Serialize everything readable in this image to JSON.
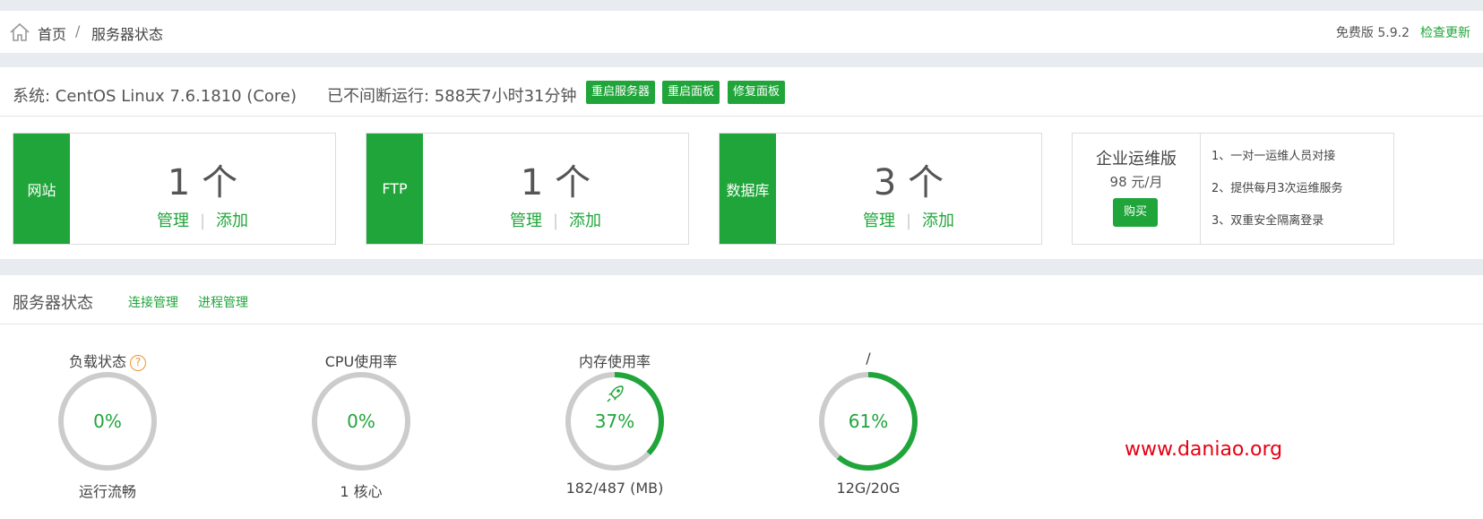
{
  "header": {
    "home_label": "首页",
    "separator": "/",
    "current": "服务器状态",
    "version": "免费版 5.9.2",
    "check_update": "检查更新"
  },
  "system": {
    "os": "系统: CentOS Linux 7.6.1810 (Core)",
    "uptime": "已不间断运行: 588天7小时31分钟",
    "buttons": [
      "重启服务器",
      "重启面板",
      "修复面板"
    ]
  },
  "cards": [
    {
      "tag": "网站",
      "count": "1 个",
      "manage": "管理",
      "add": "添加"
    },
    {
      "tag": "FTP",
      "count": "1 个",
      "manage": "管理",
      "add": "添加"
    },
    {
      "tag": "数据库",
      "count": "3 个",
      "manage": "管理",
      "add": "添加"
    }
  ],
  "enterprise": {
    "title": "企业运维版",
    "price": "98 元/月",
    "buy": "购买",
    "features": [
      "1、一对一运维人员对接",
      "2、提供每月3次运维服务",
      "3、双重安全隔离登录"
    ]
  },
  "status": {
    "title": "服务器状态",
    "links": [
      "连接管理",
      "进程管理"
    ],
    "gauges": [
      {
        "title": "负载状态",
        "help": "?",
        "value": "0%",
        "percent": 0,
        "sub": "运行流畅"
      },
      {
        "title": "CPU使用率",
        "value": "0%",
        "percent": 0,
        "sub": "1 核心"
      },
      {
        "title": "内存使用率",
        "value": "37%",
        "percent": 37,
        "sub": "182/487 (MB)"
      },
      {
        "title": "/",
        "value": "61%",
        "percent": 61,
        "sub": "12G/20G"
      }
    ]
  },
  "watermark": "www.daniao.org",
  "colors": {
    "accent": "#20a53a",
    "track": "#cccccc",
    "watermark": "#e60012"
  }
}
